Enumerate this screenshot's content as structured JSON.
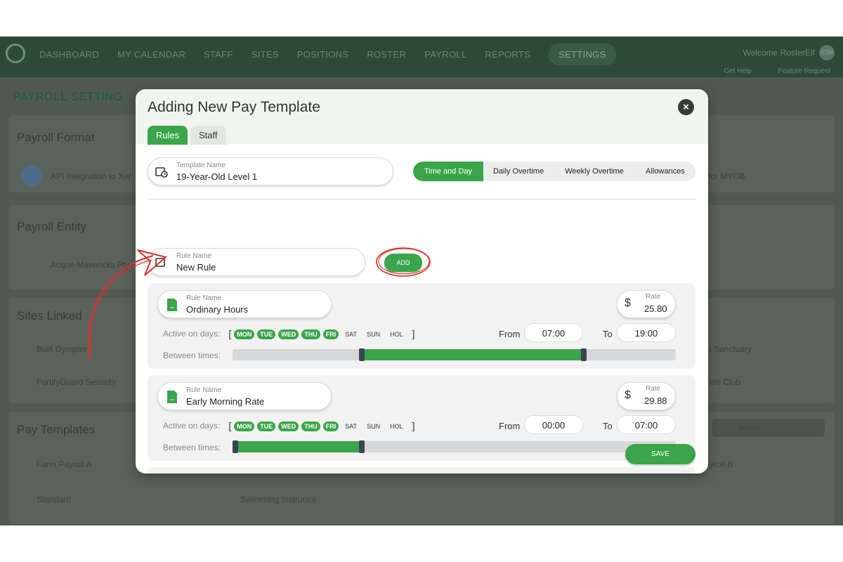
{
  "nav": {
    "items": [
      "DASHBOARD",
      "MY CALENDAR",
      "STAFF",
      "SITES",
      "POSITIONS",
      "ROSTER",
      "PAYROLL",
      "REPORTS",
      "SETTINGS"
    ],
    "active": "SETTINGS",
    "welcome": "Welcome RosterElf",
    "avatar": "RSM",
    "help": "Get Help",
    "feature": "Feature Request"
  },
  "background": {
    "page_title": "PAYROLL SETTING",
    "payroll_format": "Payroll Format",
    "api_integration": "API Integration to Xer",
    "myob": "for MYOB",
    "payroll_entity": "Payroll Entity",
    "entity_name": "Acque Mavericks Pty",
    "sites_linked": "Sites Linked",
    "site1": "Built Gympire",
    "site2": "FortifyGuard Security",
    "site3": "l Sanctuary",
    "site4": "ets Club",
    "pay_templates": "Pay Templates",
    "search": "Search",
    "tmpl1": "Farm Payroll A",
    "tmpl2": "Standard",
    "tmpl3": "Swimming Instructor",
    "tmpl4": "yroll B"
  },
  "modal": {
    "title": "Adding New Pay Template",
    "tabs": {
      "rules": "Rules",
      "staff": "Staff"
    },
    "template_name_label": "Template Name",
    "template_name_value": "19-Year-Old Level 1",
    "segments": [
      "Time and Day",
      "Daily Overtime",
      "Weekly Overtime",
      "Allowances"
    ],
    "new_rule_label": "Rule Name",
    "new_rule_value": "New Rule",
    "add_label": "ADD",
    "save_label": "SAVE",
    "active_days_label": "Active on days:",
    "between_label": "Between times:",
    "from_label": "From",
    "to_label": "To",
    "rate_label": "Rate",
    "currency": "$",
    "day_labels": [
      "MON",
      "TUE",
      "WED",
      "THU",
      "FRI",
      "SAT",
      "SUN",
      "HOL"
    ],
    "rules": [
      {
        "name_label": "Rule Name",
        "name": "Ordinary Hours",
        "rate": "25.80",
        "from": "07:00",
        "to": "19:00",
        "active_days": [
          true,
          true,
          true,
          true,
          true,
          false,
          false,
          false
        ],
        "range_start_hours": 7,
        "range_end_hours": 19
      },
      {
        "name_label": "Rule Name",
        "name": "Early Morning Rate",
        "rate": "29.88",
        "from": "00:00",
        "to": "07:00",
        "active_days": [
          true,
          true,
          true,
          true,
          true,
          false,
          false,
          false
        ],
        "range_start_hours": 0,
        "range_end_hours": 7
      }
    ]
  },
  "colors": {
    "accent": "#3aa54a",
    "handle": "#3b4450",
    "annotation": "#d9322a"
  }
}
